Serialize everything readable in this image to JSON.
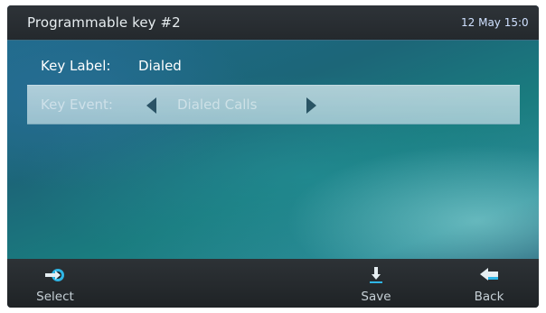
{
  "header": {
    "title": "Programmable key #2",
    "datetime": "12 May 15:0"
  },
  "form": {
    "key_label": {
      "caption": "Key Label:",
      "value": "Dialed"
    },
    "key_event": {
      "caption": "Key Event:",
      "value": "Dialed Calls"
    }
  },
  "softkeys": {
    "select": {
      "label": "Select",
      "icon": "select-arrow-icon"
    },
    "save": {
      "label": "Save",
      "icon": "save-down-arrow-icon"
    },
    "back": {
      "label": "Back",
      "icon": "back-arrow-icon"
    }
  },
  "colors": {
    "topbar": "#2b3034",
    "accent": "#2fb6e6",
    "selected_row": "#c2dce4"
  }
}
